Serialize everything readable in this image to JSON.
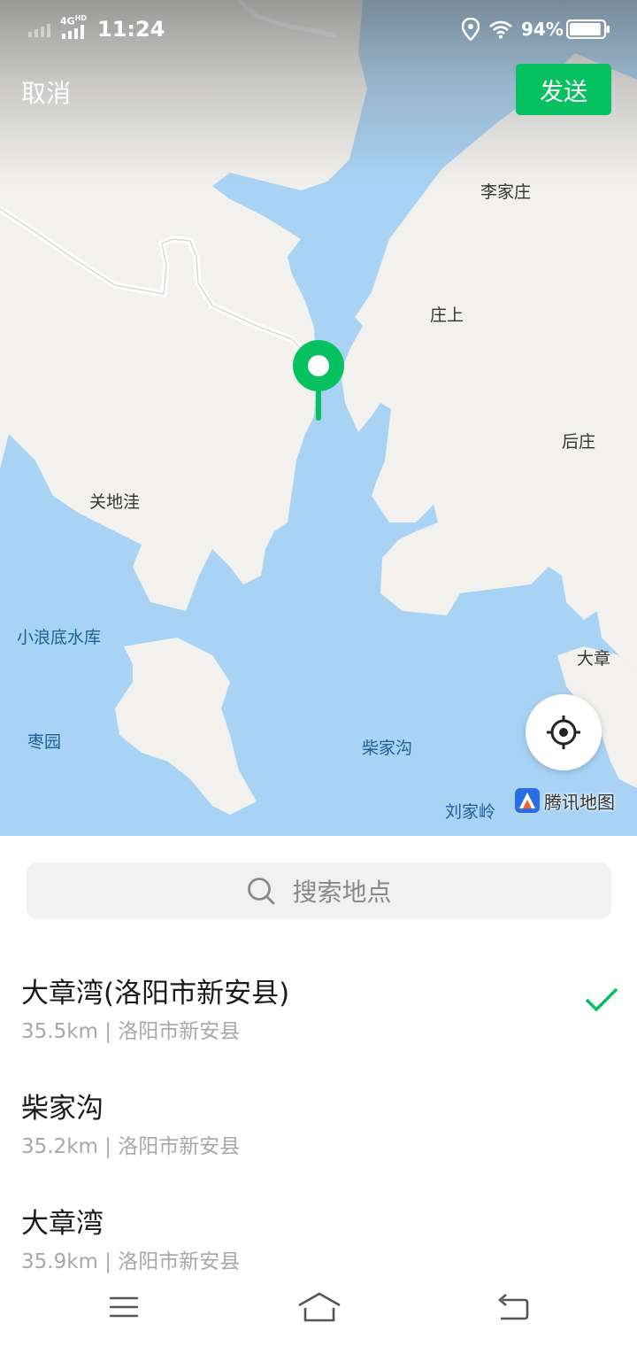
{
  "status_bar": {
    "network": "4G",
    "network_hd": "HD",
    "time": "11:24",
    "battery": "94%",
    "battery_level": 0.94
  },
  "header": {
    "cancel_label": "取消",
    "send_label": "发送"
  },
  "map": {
    "places": [
      {
        "key": "lijiazhuang",
        "name": "李家庄",
        "kind": "land"
      },
      {
        "key": "zhuangshang",
        "name": "庄上",
        "kind": "land"
      },
      {
        "key": "houzhuang",
        "name": "后庄",
        "kind": "land"
      },
      {
        "key": "guandiwa",
        "name": "关地洼",
        "kind": "land"
      },
      {
        "key": "xiaolangdi",
        "name": "小浪底水库",
        "kind": "water"
      },
      {
        "key": "dazhang",
        "name": "大章",
        "kind": "land"
      },
      {
        "key": "zaoyuan",
        "name": "枣园",
        "kind": "water"
      },
      {
        "key": "chaijiagou",
        "name": "柴家沟",
        "kind": "water"
      },
      {
        "key": "liujialing",
        "name": "刘家岭",
        "kind": "water"
      }
    ],
    "logo_text": "腾讯地图",
    "colors": {
      "water": "#a9d3f5",
      "land": "#f2f1ee",
      "pin": "#07c160"
    }
  },
  "search": {
    "placeholder": "搜索地点"
  },
  "results": [
    {
      "name": "大章湾(洛阳市新安县)",
      "subtitle": "35.5km | 洛阳市新安县",
      "selected": true
    },
    {
      "name": "柴家沟",
      "subtitle": "35.2km | 洛阳市新安县",
      "selected": false
    },
    {
      "name": "大章湾",
      "subtitle": "35.9km | 洛阳市新安县",
      "selected": false
    }
  ],
  "nav": {
    "icons": [
      "menu-icon",
      "home-icon",
      "back-icon"
    ]
  },
  "accent": "#07c160"
}
